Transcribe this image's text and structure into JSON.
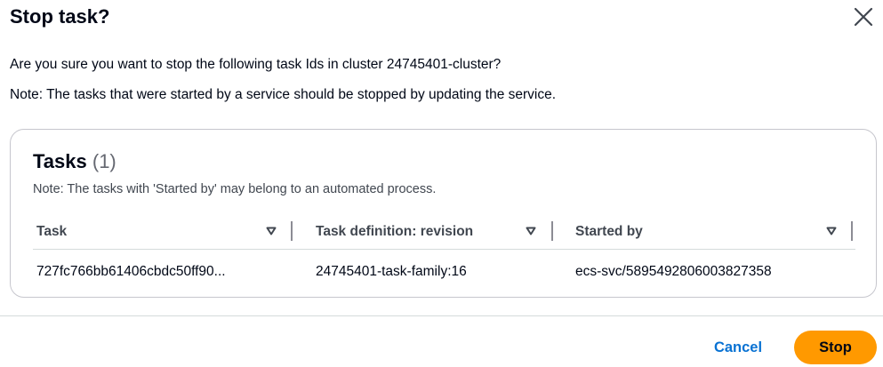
{
  "modal": {
    "title": "Stop task?",
    "confirm_text": "Are you sure you want to stop the following task Ids in cluster 24745401-cluster?",
    "note_text": "Note: The tasks that were started by a service should be stopped by updating the service."
  },
  "tasks": {
    "header": "Tasks",
    "count": "(1)",
    "note": "Note: The tasks with 'Started by' may belong to an automated process.",
    "columns": [
      "Task",
      "Task definition: revision",
      "Started by"
    ],
    "rows": [
      [
        "727fc766bb61406cbdc50ff90...",
        "24745401-task-family:16",
        "ecs-svc/5895492806003827358"
      ]
    ]
  },
  "footer": {
    "cancel_label": "Cancel",
    "stop_label": "Stop"
  },
  "icons": {
    "close": "close-icon",
    "sort": "caret-down-icon"
  },
  "colors": {
    "primary_button": "#ff9900",
    "link": "#0972d3"
  }
}
